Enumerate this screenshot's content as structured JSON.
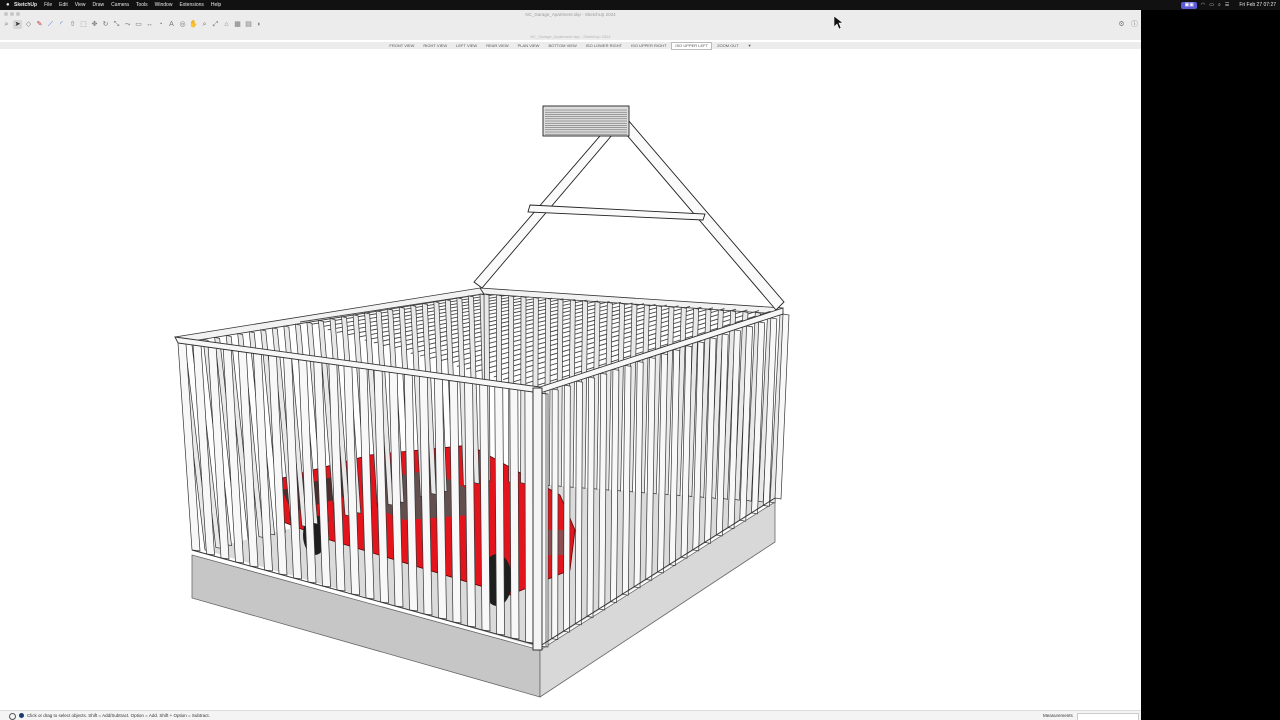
{
  "menubar": {
    "apple": "",
    "items": [
      "SketchUp",
      "File",
      "Edit",
      "View",
      "Draw",
      "Camera",
      "Tools",
      "Window",
      "Extensions",
      "Help"
    ],
    "status_icons": [
      "wifi-icon",
      "battery-icon",
      "search-icon",
      "control-center-icon"
    ],
    "clock": "Fri Feb 27  07:27"
  },
  "window": {
    "title": "NC_Garage_Apartment.skp - SketchUp 2024",
    "doc_title": "NC_Garage_Apartment.skp - SketchUp 2024"
  },
  "scenes": {
    "tabs": [
      "FRONT VIEW",
      "RIGHT VIEW",
      "LEFT VIEW",
      "REAR VIEW",
      "PLAN VIEW",
      "BOTTOM VIEW",
      "ISO LOWER RIGHT",
      "ISO UPPER RIGHT",
      "ISO UPPER LEFT",
      "ZOOM OUT"
    ],
    "active": "ISO UPPER LEFT",
    "more": "▼"
  },
  "statusbar": {
    "hint": "Click or drag to select objects. Shift = Add/Subtract. Option = Add. Shift + Option = Subtract.",
    "measurements_label": "Measurements"
  },
  "colors": {
    "truck": "#e3141b",
    "frame": "#cfcfcf",
    "slab": "#c4c4c4"
  }
}
